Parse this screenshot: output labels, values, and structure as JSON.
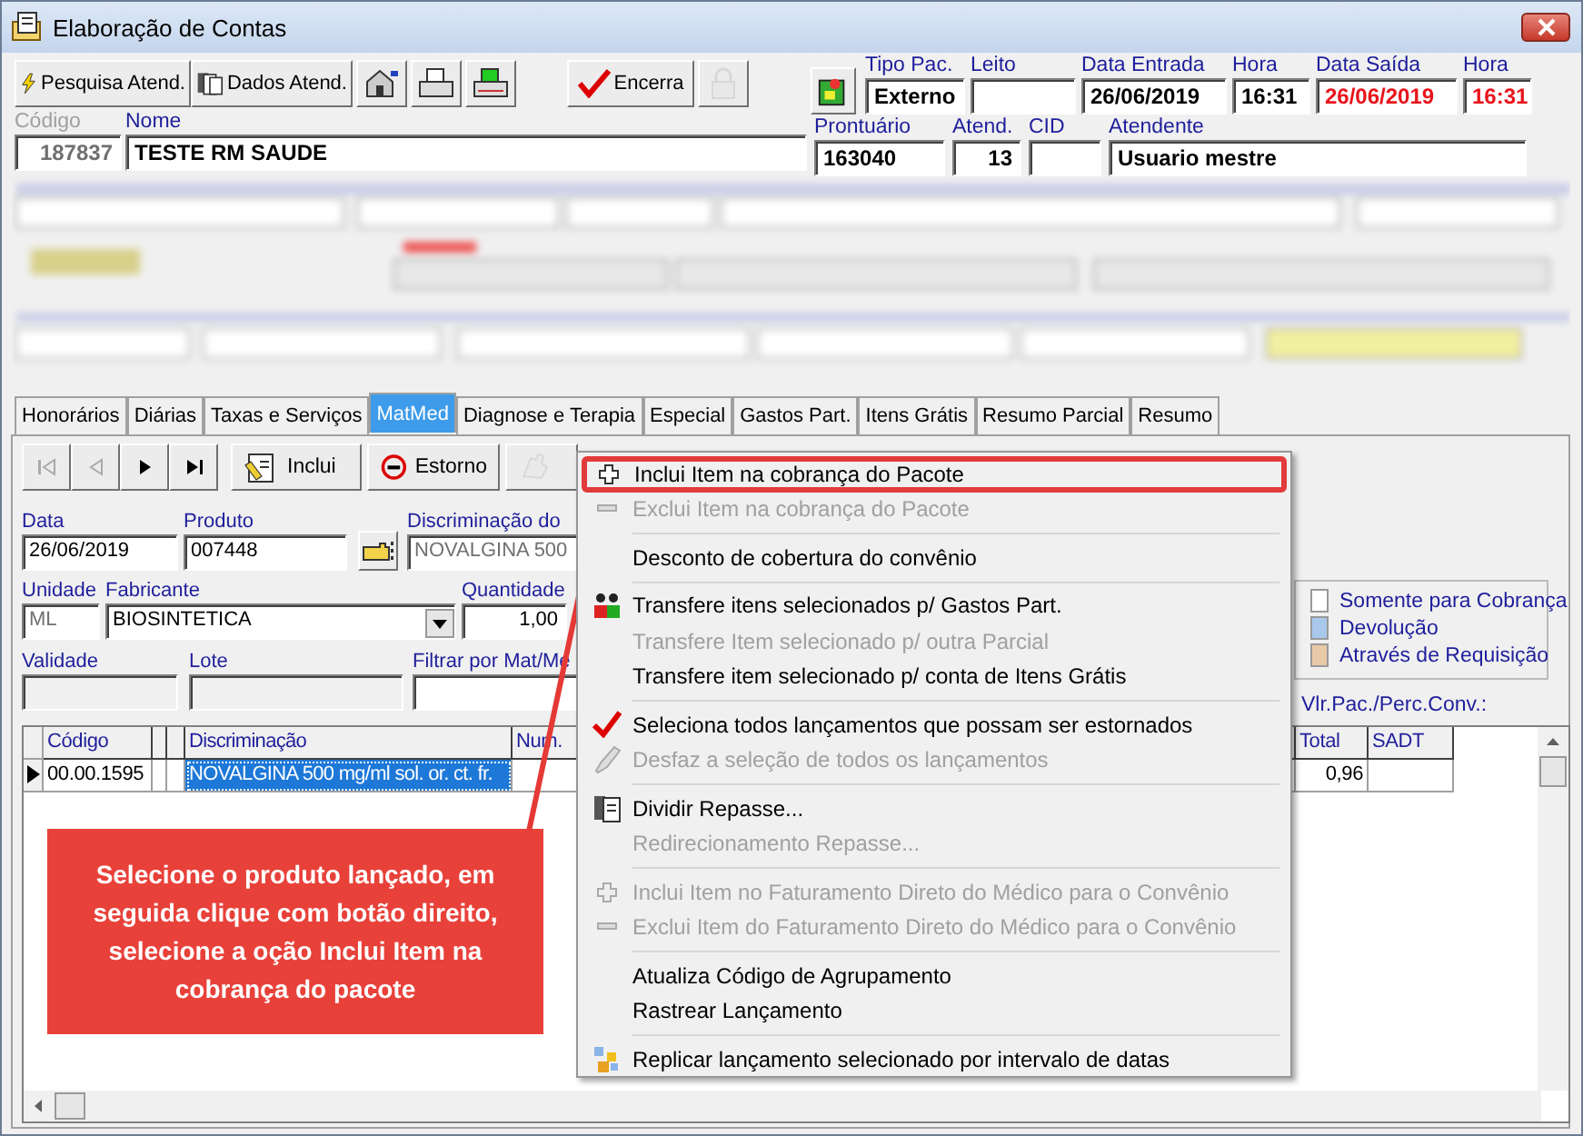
{
  "window": {
    "title": "Elaboração de Contas"
  },
  "toolbar": [
    {
      "kind": "text",
      "label": "Pesquisa Atend.",
      "disabled": false
    },
    {
      "kind": "text",
      "label": "Dados Atend.",
      "disabled": false
    },
    {
      "kind": "icon"
    },
    {
      "kind": "icon"
    },
    {
      "kind": "icon"
    },
    {
      "kind": "text",
      "label": "Encerra",
      "disabled": false
    },
    {
      "kind": "icon",
      "disabled": true
    }
  ],
  "header": {
    "identity": [
      {
        "label": "Código",
        "value": "187837",
        "disabled": true,
        "alert": false
      },
      {
        "label": "Nome",
        "value": "TESTE RM SAUDE",
        "disabled": false,
        "alert": false
      }
    ],
    "admission": [
      {
        "label": "Tipo Pac.",
        "value": "Externo",
        "disabled": false,
        "alert": false
      },
      {
        "label": "Leito"
      },
      {
        "label": "Data Entrada",
        "value": "26/06/2019",
        "disabled": false,
        "alert": false
      },
      {
        "label": "Hora",
        "value": "16:31",
        "disabled": false,
        "alert": false
      },
      {
        "label": "Data Saída",
        "value": "26/06/2019",
        "disabled": false,
        "alert": true
      },
      {
        "label": "Hora",
        "value": "16:31",
        "disabled": false,
        "alert": true
      }
    ],
    "record": [
      {
        "label": "Prontuário",
        "value": "163040",
        "disabled": false,
        "alert": false
      },
      {
        "label": "Atend.",
        "value": "13",
        "disabled": false,
        "alert": false
      },
      {
        "label": "CID"
      },
      {
        "label": "Atendente",
        "value": "Usuario mestre",
        "disabled": false,
        "alert": false
      }
    ]
  },
  "tabs": [
    {
      "label": "Honorários",
      "selected": false
    },
    {
      "label": "Diárias",
      "selected": false
    },
    {
      "label": "Taxas e Serviços",
      "selected": false
    },
    {
      "label": "MatMed",
      "selected": true
    },
    {
      "label": "Diagnose e Terapia",
      "selected": false
    },
    {
      "label": "Especial",
      "selected": false
    },
    {
      "label": "Gastos Part.",
      "selected": false
    },
    {
      "label": "Itens Grátis",
      "selected": false
    },
    {
      "label": "Resumo Parcial",
      "selected": false
    },
    {
      "label": "Resumo",
      "selected": false
    }
  ],
  "navigation": [
    {
      "kind": "first",
      "disabled": true
    },
    {
      "kind": "prev",
      "disabled": true
    },
    {
      "kind": "next",
      "disabled": false
    },
    {
      "kind": "last",
      "disabled": false
    }
  ],
  "actions": [
    {
      "kind": "text",
      "label": "Inclui",
      "disabled": false
    },
    {
      "kind": "text",
      "label": "Estorno",
      "disabled": false
    },
    {
      "kind": "icon",
      "disabled": true
    }
  ],
  "form": [
    [
      {
        "kind": "field",
        "label": "Data",
        "value": "26/06/2019",
        "disabled": false
      },
      {
        "kind": "field",
        "label": "Produto",
        "value": "007448",
        "disabled": false
      },
      {
        "kind": "lookup",
        "disabled": false
      },
      {
        "kind": "field",
        "label": "Discriminação do",
        "value": "NOVALGINA 500",
        "disabled": true
      }
    ],
    [
      {
        "kind": "field",
        "label": "Unidade",
        "value": "ML",
        "disabled": true
      },
      {
        "kind": "combo",
        "label": "Fabricante",
        "value": "BIOSINTETICA",
        "disabled": false
      },
      {
        "kind": "field",
        "label": "Quantidade",
        "value": "1,00",
        "disabled": false
      }
    ],
    [
      {
        "kind": "field",
        "label": "Validade",
        "disabled": true
      },
      {
        "kind": "field",
        "label": "Lote",
        "disabled": true
      },
      {
        "kind": "field",
        "label": "Filtrar por Mat/Me",
        "disabled": false
      }
    ]
  ],
  "legend": [
    {
      "label": "Somente para Cobrança",
      "color": "#ffffff"
    },
    {
      "label": "Devolução",
      "color": "#a9c8ec"
    },
    {
      "label": "Através de Requisição",
      "color": "#e8c9a8"
    }
  ],
  "package_label": "Vlr.Pac./Perc.Conv.:",
  "grid": {
    "columns": [
      {
        "kind": "text",
        "label": "Código"
      },
      {
        "kind": "blank"
      },
      {
        "kind": "blank"
      },
      {
        "kind": "text",
        "label": "Discriminação"
      },
      {
        "kind": "text",
        "label": "Num."
      },
      {
        "kind": "text",
        "label": "Total"
      },
      {
        "kind": "text",
        "label": "SADT"
      }
    ],
    "rows": [
      {
        "current": true,
        "cells": [
          {
            "text": "00.00.1595",
            "selected": false
          },
          {
            "selected": false
          },
          {
            "selected": false
          },
          {
            "text": "NOVALGINA 500 mg/ml sol. or. ct. fr.",
            "selected": true
          },
          {
            "selected": false
          },
          {
            "text": "0,96",
            "selected": false
          },
          {
            "selected": false
          }
        ]
      }
    ]
  },
  "callout": "Selecione o produto lançado, em seguida clique com botão direito, selecione a oção Inclui Item na cobrança do pacote",
  "context_menu": [
    {
      "kind": "item",
      "label": "Inclui Item na cobrança do Pacote",
      "disabled": false,
      "selected": true
    },
    {
      "kind": "item",
      "label": "Exclui Item na cobrança do Pacote",
      "disabled": true,
      "selected": false
    },
    {
      "kind": "separator"
    },
    {
      "kind": "item",
      "label": "Desconto de cobertura do convênio",
      "disabled": false,
      "selected": false
    },
    {
      "kind": "separator"
    },
    {
      "kind": "item",
      "label": "Transfere itens selecionados p/ Gastos Part.",
      "disabled": false,
      "selected": false
    },
    {
      "kind": "item",
      "label": "Transfere Item selecionado p/ outra Parcial",
      "disabled": true,
      "selected": false
    },
    {
      "kind": "item",
      "label": "Transfere item selecionado p/ conta de Itens Grátis",
      "disabled": false,
      "selected": false
    },
    {
      "kind": "separator"
    },
    {
      "kind": "item",
      "label": "Seleciona todos lançamentos que possam ser estornados",
      "disabled": false,
      "selected": false
    },
    {
      "kind": "item",
      "label": "Desfaz a seleção de todos os lançamentos",
      "disabled": true,
      "selected": false
    },
    {
      "kind": "separator"
    },
    {
      "kind": "item",
      "label": "Dividir Repasse...",
      "disabled": false,
      "selected": false
    },
    {
      "kind": "item",
      "label": "Redirecionamento Repasse...",
      "disabled": true,
      "selected": false
    },
    {
      "kind": "separator"
    },
    {
      "kind": "item",
      "label": "Inclui Item no Faturamento Direto do Médico para o Convênio",
      "disabled": true,
      "selected": false
    },
    {
      "kind": "item",
      "label": "Exclui Item do Faturamento Direto do Médico para o Convênio",
      "disabled": true,
      "selected": false
    },
    {
      "kind": "separator"
    },
    {
      "kind": "item",
      "label": "Atualiza Código de Agrupamento",
      "disabled": false,
      "selected": false
    },
    {
      "kind": "item",
      "label": "Rastrear Lançamento",
      "disabled": false,
      "selected": false
    },
    {
      "kind": "separator"
    },
    {
      "kind": "item",
      "label": "Replicar lançamento selecionado por intervalo de datas",
      "disabled": false,
      "selected": false
    }
  ]
}
